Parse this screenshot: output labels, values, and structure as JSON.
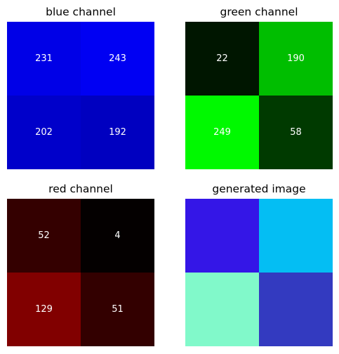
{
  "chart_data": [
    {
      "type": "heatmap",
      "title": "blue channel",
      "channel": "blue",
      "values": [
        [
          231,
          243
        ],
        [
          202,
          192
        ]
      ]
    },
    {
      "type": "heatmap",
      "title": "green channel",
      "channel": "green",
      "values": [
        [
          22,
          190
        ],
        [
          249,
          58
        ]
      ]
    },
    {
      "type": "heatmap",
      "title": "red channel",
      "channel": "red",
      "values": [
        [
          52,
          4
        ],
        [
          129,
          51
        ]
      ]
    },
    {
      "type": "heatmap",
      "title": "generated image",
      "channel": "rgb",
      "values": [
        [
          [
            52,
            22,
            231
          ],
          [
            4,
            190,
            243
          ]
        ],
        [
          [
            129,
            249,
            202
          ],
          [
            51,
            58,
            192
          ]
        ]
      ]
    }
  ]
}
